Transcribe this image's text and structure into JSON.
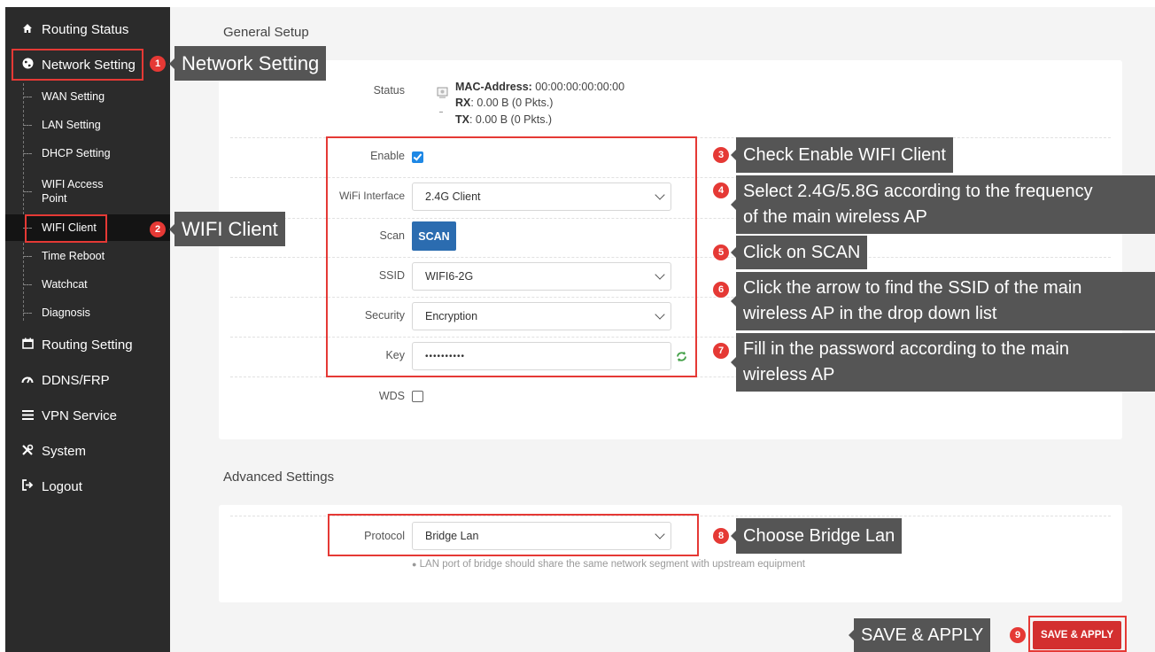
{
  "sidebar": {
    "routing_status": "Routing Status",
    "network_setting": "Network Setting",
    "sub_items": [
      "WAN Setting",
      "LAN Setting",
      "DHCP Setting",
      "WIFI Access Point",
      "WIFI Client",
      "Time Reboot",
      "Watchcat",
      "Diagnosis"
    ],
    "routing_setting": "Routing Setting",
    "ddns": "DDNS/FRP",
    "vpn": "VPN Service",
    "system": "System",
    "logout": "Logout"
  },
  "general": {
    "title": "General Setup",
    "status_label": "Status",
    "mac_label": "MAC-Address:",
    "mac_value": "00:00:00:00:00:00",
    "rx_label": "RX",
    "rx_value": ": 0.00 B (0 Pkts.)",
    "tx_label": "TX",
    "tx_value": ": 0.00 B (0 Pkts.)",
    "enable_label": "Enable",
    "enable_checked": true,
    "wifi_interface_label": "WiFi Interface",
    "wifi_interface_value": "2.4G Client",
    "scan_label": "Scan",
    "scan_button": "SCAN",
    "ssid_label": "SSID",
    "ssid_value": "WIFI6-2G",
    "security_label": "Security",
    "security_value": "Encryption",
    "key_label": "Key",
    "key_value": "••••••••••",
    "wds_label": "WDS",
    "wds_checked": false
  },
  "advanced": {
    "title": "Advanced Settings",
    "protocol_label": "Protocol",
    "protocol_value": "Bridge Lan",
    "hint": "LAN port of bridge should share the same network segment with upstream equipment"
  },
  "save_button": "SAVE & APPLY",
  "annotations": {
    "a1": "Network Setting",
    "a2": "WIFI Client",
    "a3": "Check Enable WIFI Client",
    "a4_line1": "Select 2.4G/5.8G according to the frequency",
    "a4_line2": "of the main wireless AP",
    "a5": "Click on SCAN",
    "a6_line1": "Click the arrow to find the SSID of the main",
    "a6_line2": "wireless AP in the drop down list",
    "a7_line1": "Fill in the password according to the main",
    "a7_line2": "wireless AP",
    "a8": "Choose Bridge Lan",
    "a9": "SAVE & APPLY"
  },
  "badges": [
    "1",
    "2",
    "3",
    "4",
    "5",
    "6",
    "7",
    "8",
    "9"
  ],
  "colors": {
    "sidebar_bg": "#2b2b2b",
    "accent_blue": "#2b6cb0",
    "highlight_red": "#e53935",
    "callout_bg": "#555555"
  }
}
